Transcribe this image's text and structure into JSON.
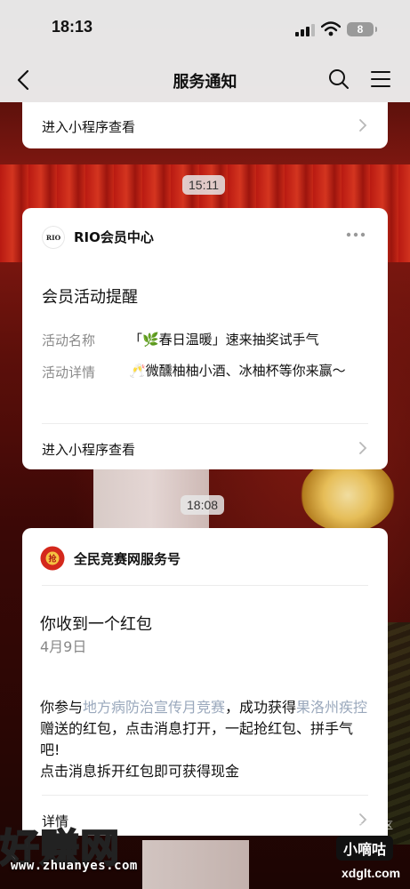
{
  "status_bar": {
    "time": "18:13",
    "battery": "8"
  },
  "nav": {
    "title": "服务通知"
  },
  "cards": [
    {
      "link_label": "进入小程序查看"
    },
    {
      "time": "15:11",
      "account_name": "RIO会员中心",
      "avatar_text": "RIO",
      "title": "会员活动提醒",
      "fields": [
        {
          "label": "活动名称",
          "value": "「🌿春日温暖」速来抽奖试手气"
        },
        {
          "label": "活动详情",
          "value": "🥂微醺柚柚小酒、冰柚杯等你来赢～"
        }
      ],
      "link_label": "进入小程序查看"
    },
    {
      "time": "18:08",
      "account_name": "全民竞赛网服务号",
      "avatar_text": "抢",
      "title": "你收到一个红包",
      "date": "4月9日",
      "body_parts": {
        "p1": "你参与",
        "h1": "地方病防治宣传月竞赛",
        "p2": "，成功获得",
        "h2": "果洛州疾控",
        "p3": "赠送的红包，点击消息打开，一起抢红包、拼手气吧!"
      },
      "body_line2": "点击消息拆开红包即可获得现金",
      "link_label": "详情"
    }
  ],
  "watermarks": {
    "brand": "好赚网",
    "url": "www.zhuanyes.com",
    "small": "接报音爆社区",
    "badge": "小嘀咕",
    "domain": "xdglt.com"
  }
}
